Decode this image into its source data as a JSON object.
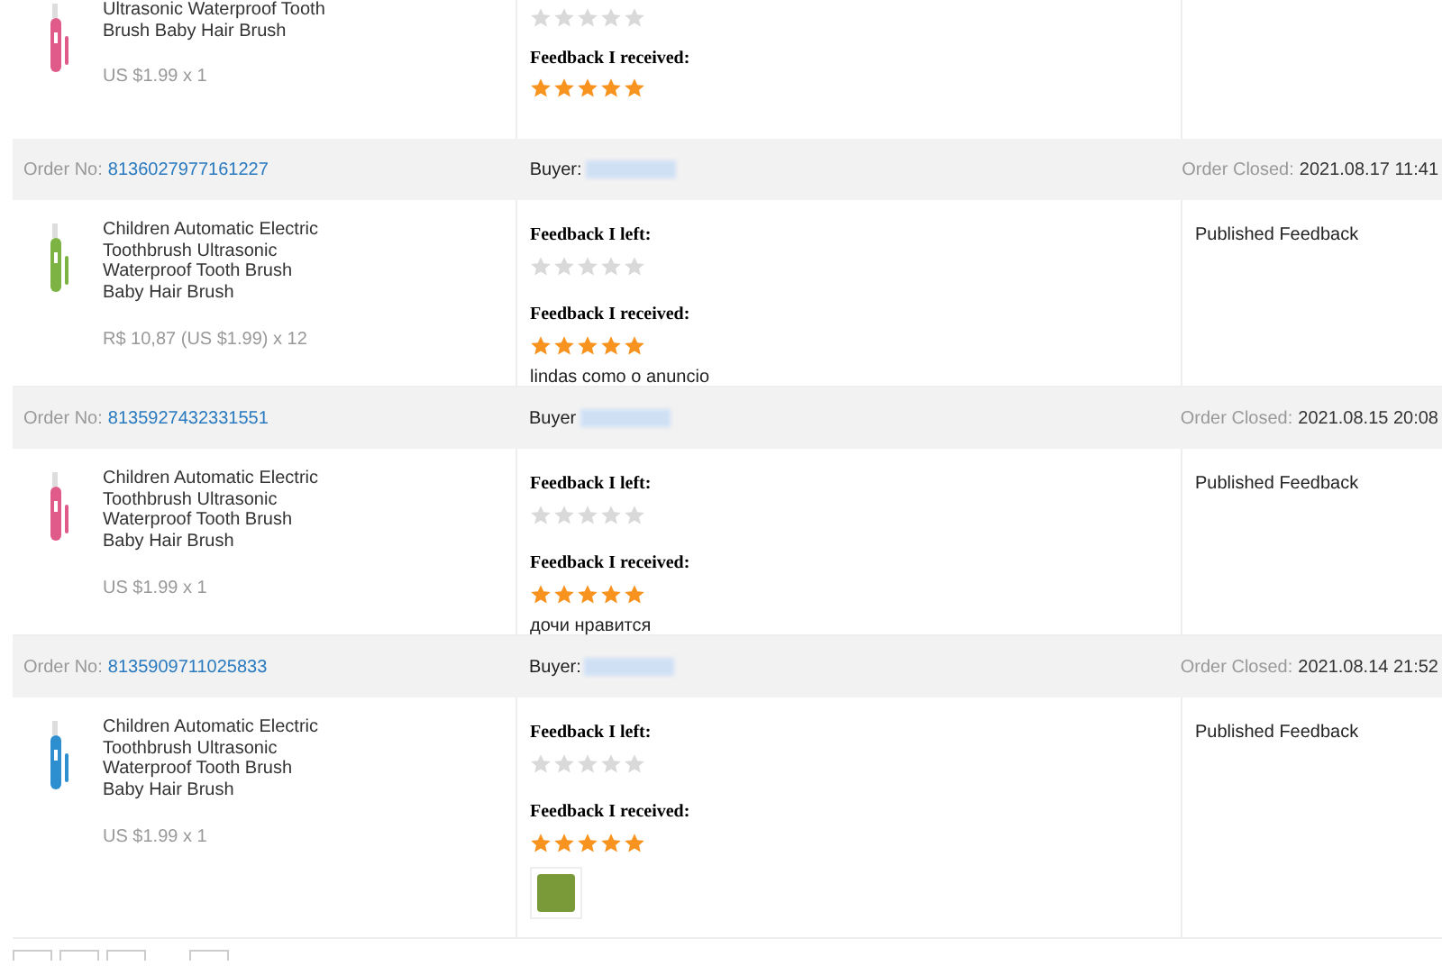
{
  "partial_order": {
    "product": {
      "title": "Ultrasonic Waterproof Tooth Brush Baby Hair Brush",
      "price": "US $1.99 x 1",
      "color": "#e05a8a"
    },
    "feedback_left": {
      "stars": 0
    },
    "feedback_received": {
      "label": "Feedback I received:",
      "stars": 5
    }
  },
  "orders": [
    {
      "order_label": "Order No:",
      "order_no": "8136027977161227",
      "buyer_label": "Buyer:",
      "closed_label": "Order Closed:",
      "closed_date": "2021.08.17 11:41",
      "product": {
        "title": "Children Automatic Electric Toothbrush Ultrasonic Waterproof Tooth Brush Baby Hair Brush",
        "price": "R$ 10,87 (US $1.99) x 12",
        "color": "#7cb342"
      },
      "feedback_left": {
        "label": "Feedback I left:",
        "stars": 0
      },
      "feedback_received": {
        "label": "Feedback I received:",
        "stars": 5
      },
      "comment": "lindas como o anuncio",
      "has_photo": false,
      "status": "Published Feedback"
    },
    {
      "order_label": "Order No:",
      "order_no": "8135927432331551",
      "buyer_label": "Buyer",
      "closed_label": "Order Closed:",
      "closed_date": "2021.08.15 20:08",
      "product": {
        "title": "Children Automatic Electric Toothbrush Ultrasonic Waterproof Tooth Brush Baby Hair Brush",
        "price": "US $1.99 x 1",
        "color": "#e05a8a"
      },
      "feedback_left": {
        "label": "Feedback I left:",
        "stars": 0
      },
      "feedback_received": {
        "label": "Feedback I received:",
        "stars": 5
      },
      "comment": "дочи нравится",
      "has_photo": false,
      "status": "Published Feedback"
    },
    {
      "order_label": "Order No:",
      "order_no": "8135909711025833",
      "buyer_label": "Buyer:",
      "closed_label": "Order Closed:",
      "closed_date": "2021.08.14 21:52",
      "product": {
        "title": "Children Automatic Electric Toothbrush Ultrasonic Waterproof Tooth Brush Baby Hair Brush",
        "price": "US $1.99 x 1",
        "color": "#2e8fd0"
      },
      "feedback_left": {
        "label": "Feedback I left:",
        "stars": 0
      },
      "feedback_received": {
        "label": "Feedback I received:",
        "stars": 5
      },
      "has_photo": true,
      "status": "Published Feedback"
    }
  ]
}
